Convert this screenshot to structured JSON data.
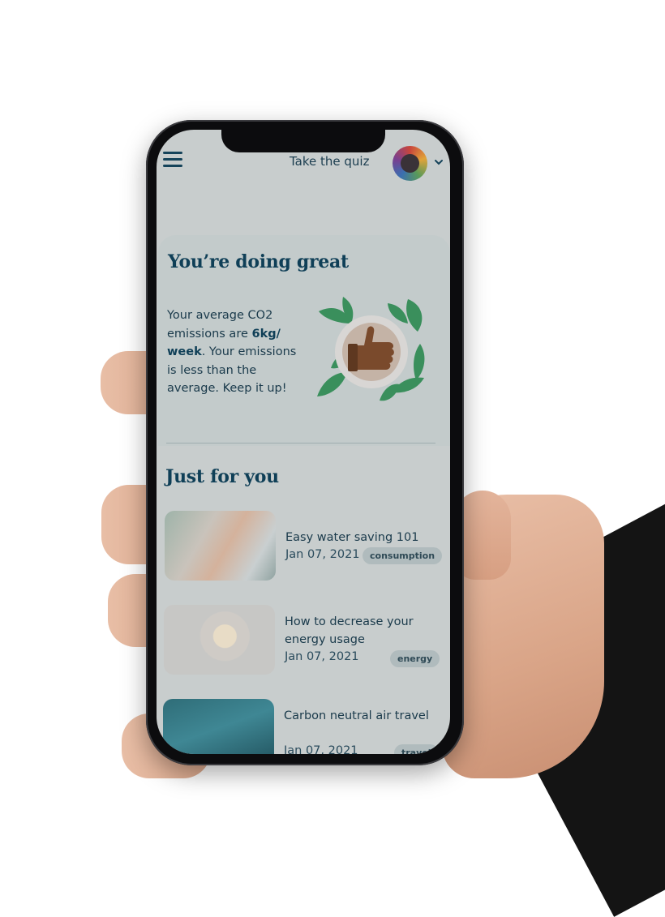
{
  "header": {
    "quiz_link": "Take the quiz"
  },
  "hero": {
    "title": "You’re doing great",
    "text_before": "Your average CO2 emissions are ",
    "text_bold": "6kg/ week",
    "text_after": ". Your emissions is less than the average. Keep it up!"
  },
  "section": {
    "title": "Just for you"
  },
  "articles": [
    {
      "title": "Easy water saving 101",
      "date": "Jan 07, 2021",
      "tag": "consumption"
    },
    {
      "title": "How to decrease your energy usage",
      "date": "Jan 07, 2021",
      "tag": "energy"
    },
    {
      "title": "Carbon neutral air travel",
      "date": "Jan 07, 2021",
      "tag": "travel"
    }
  ],
  "colors": {
    "primary": "#0f3f57",
    "screen_bg": "#c8cdcd",
    "tag_bg": "#b0bbbd",
    "leaf": "#3a8f5c"
  },
  "icons": [
    "menu-icon",
    "avatar",
    "chevron-down-icon",
    "thumbs-up-icon"
  ]
}
